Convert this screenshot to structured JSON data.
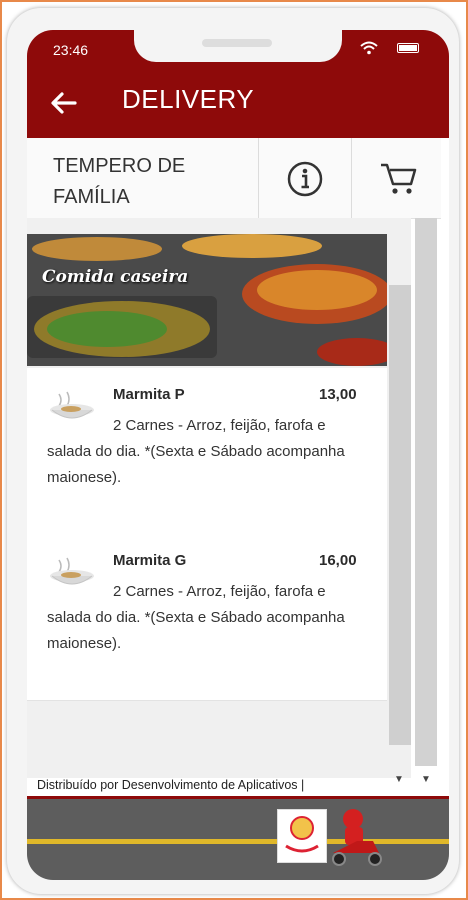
{
  "status_bar": {
    "time": "23:46"
  },
  "app_bar": {
    "title": "DELIVERY"
  },
  "restaurant": {
    "name": "TEMPERO DE FAMÍLIA"
  },
  "banner": {
    "caption": "Comida caseira"
  },
  "menu_items": [
    {
      "name": "Marmita P",
      "price": "13,00",
      "description": "2 Carnes - Arroz, feijão, farofa e salada do dia. *(Sexta e Sábado acompanha maionese)."
    },
    {
      "name": "Marmita G",
      "price": "16,00",
      "description": "2 Carnes - Arroz, feijão, farofa e salada do dia. *(Sexta e Sábado acompanha maionese)."
    }
  ],
  "footer": {
    "text": "Distribuído por Desenvolvimento de Aplicativos |"
  },
  "colors": {
    "brand": "#8e0a0a",
    "accent_frame": "#e8894a"
  },
  "icons": [
    "back-arrow-icon",
    "info-icon",
    "cart-icon",
    "wifi-icon",
    "battery-icon",
    "food-bowl-icon"
  ]
}
